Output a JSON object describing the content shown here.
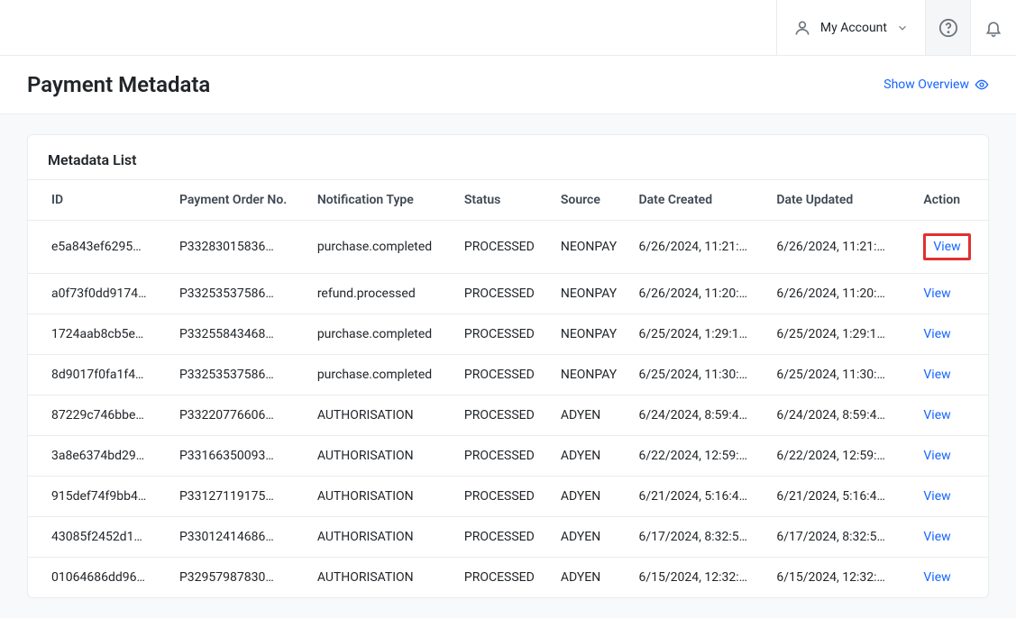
{
  "top": {
    "account_label": "My Account"
  },
  "header": {
    "title": "Payment Metadata",
    "overview_label": "Show Overview"
  },
  "card": {
    "title": "Metadata List",
    "columns": {
      "id": "ID",
      "order": "Payment Order No.",
      "type": "Notification Type",
      "status": "Status",
      "source": "Source",
      "created": "Date Created",
      "updated": "Date Updated",
      "action": "Action"
    },
    "action_label": "View",
    "rows": [
      {
        "id": "e5a843ef6295…",
        "order": "P33283015836…",
        "type": "purchase.completed",
        "status": "PROCESSED",
        "source": "NEONPAY",
        "created": "6/26/2024, 11:21:…",
        "updated": "6/26/2024, 11:21:…"
      },
      {
        "id": "a0f73f0dd9174…",
        "order": "P33253537586…",
        "type": "refund.processed",
        "status": "PROCESSED",
        "source": "NEONPAY",
        "created": "6/26/2024, 11:20:…",
        "updated": "6/26/2024, 11:20:…"
      },
      {
        "id": "1724aab8cb5e…",
        "order": "P33255843468…",
        "type": "purchase.completed",
        "status": "PROCESSED",
        "source": "NEONPAY",
        "created": "6/25/2024, 1:29:1…",
        "updated": "6/25/2024, 1:29:1…"
      },
      {
        "id": "8d9017f0fa1f4…",
        "order": "P33253537586…",
        "type": "purchase.completed",
        "status": "PROCESSED",
        "source": "NEONPAY",
        "created": "6/25/2024, 11:30:…",
        "updated": "6/25/2024, 11:30:…"
      },
      {
        "id": "87229c746bbe…",
        "order": "P33220776606…",
        "type": "AUTHORISATION",
        "status": "PROCESSED",
        "source": "ADYEN",
        "created": "6/24/2024, 8:59:4…",
        "updated": "6/24/2024, 8:59:4…"
      },
      {
        "id": "3a8e6374bd29…",
        "order": "P33166350093…",
        "type": "AUTHORISATION",
        "status": "PROCESSED",
        "source": "ADYEN",
        "created": "6/22/2024, 12:59:…",
        "updated": "6/22/2024, 12:59:…"
      },
      {
        "id": "915def74f9bb4…",
        "order": "P33127119175…",
        "type": "AUTHORISATION",
        "status": "PROCESSED",
        "source": "ADYEN",
        "created": "6/21/2024, 5:16:4…",
        "updated": "6/21/2024, 5:16:4…"
      },
      {
        "id": "43085f2452d1…",
        "order": "P33012414686…",
        "type": "AUTHORISATION",
        "status": "PROCESSED",
        "source": "ADYEN",
        "created": "6/17/2024, 8:32:5…",
        "updated": "6/17/2024, 8:32:5…"
      },
      {
        "id": "01064686dd96…",
        "order": "P32957987830…",
        "type": "AUTHORISATION",
        "status": "PROCESSED",
        "source": "ADYEN",
        "created": "6/15/2024, 12:32:…",
        "updated": "6/15/2024, 12:32:…"
      }
    ]
  }
}
